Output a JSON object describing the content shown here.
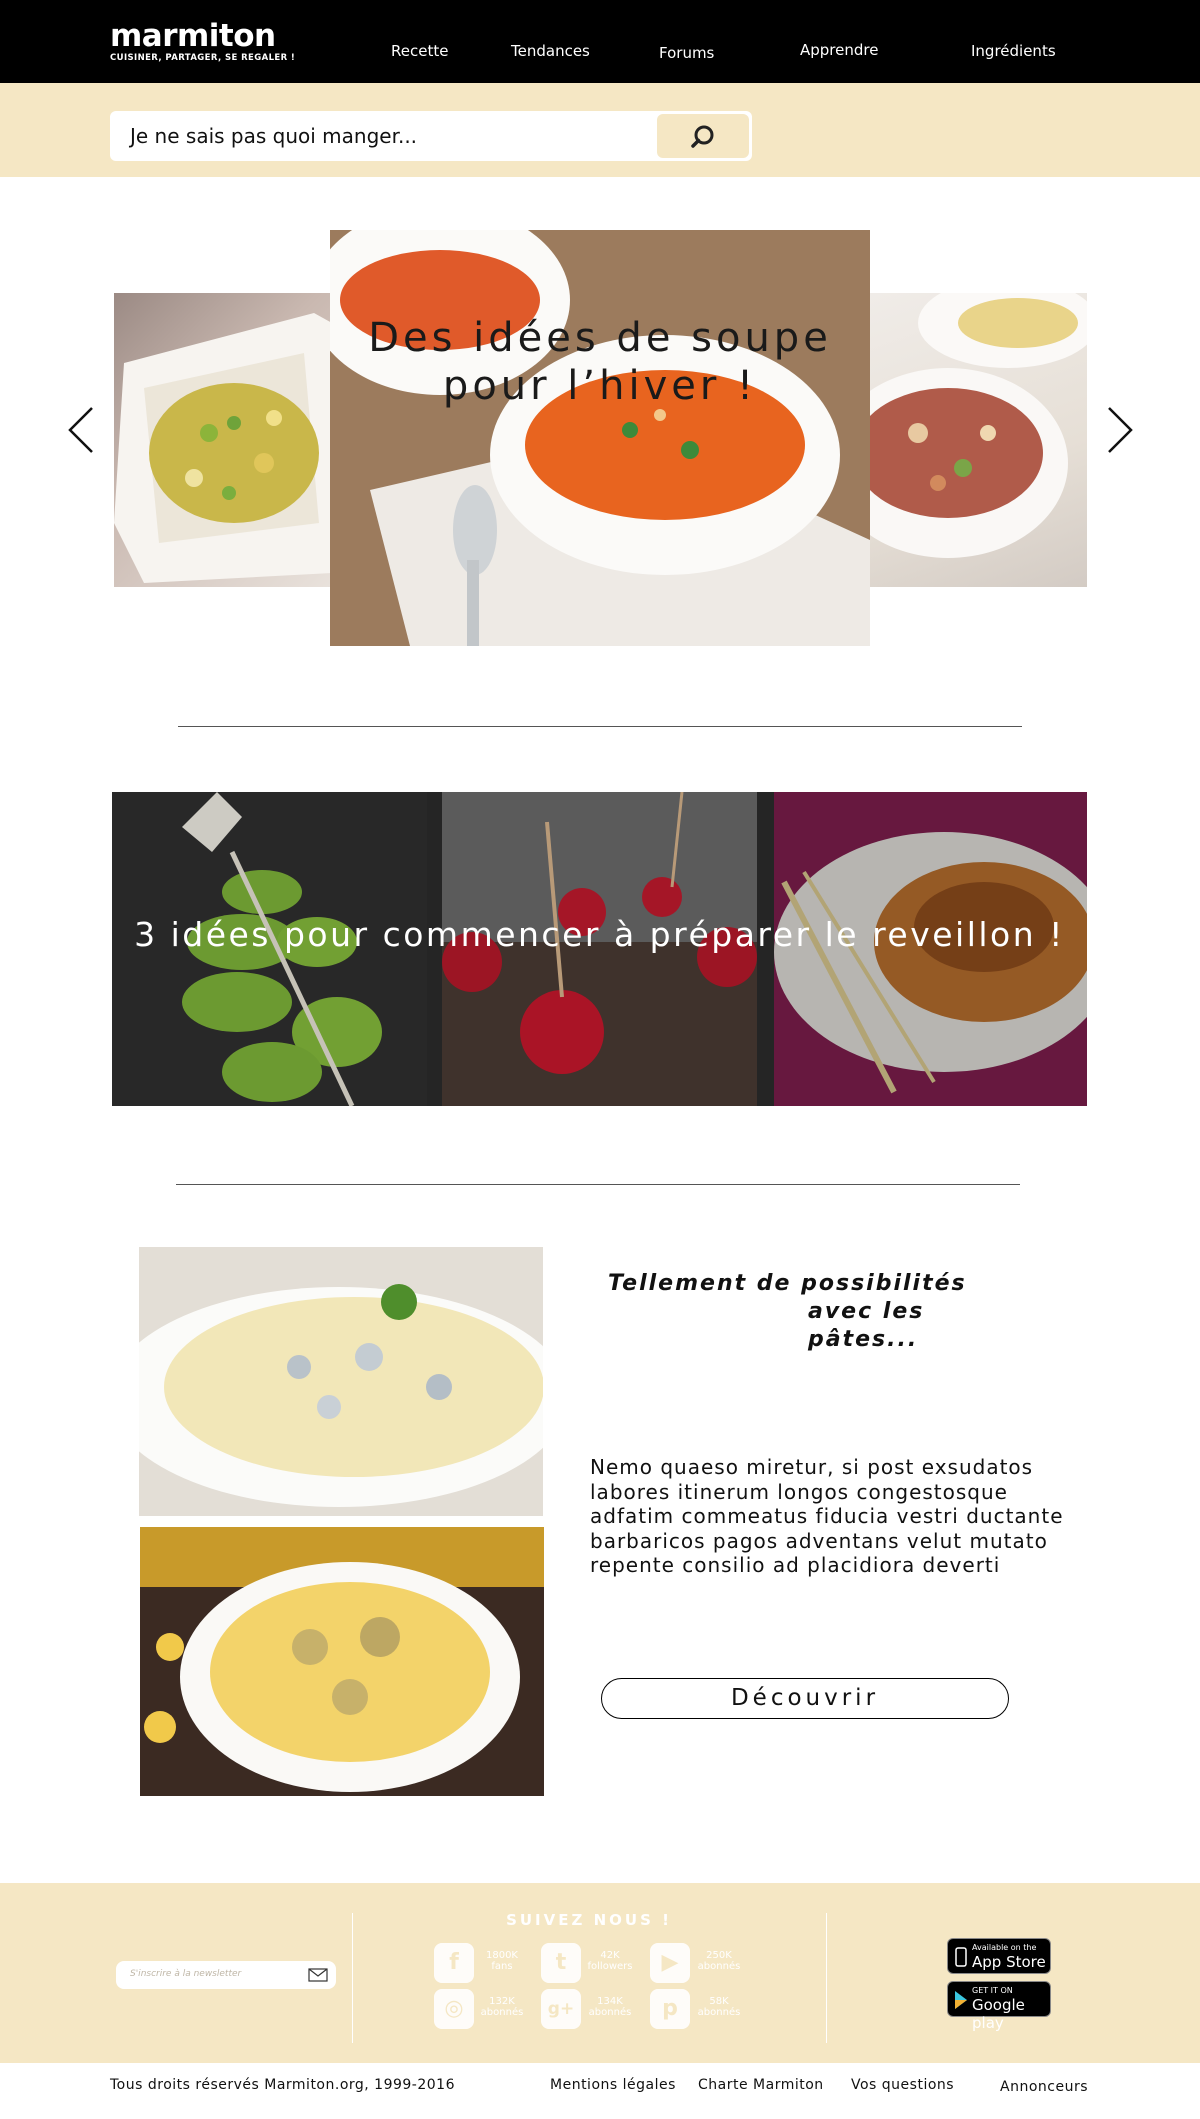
{
  "header": {
    "logo_word": "marmiton",
    "logo_tagline": "CUISINER, PARTAGER, SE REGALER !",
    "nav": [
      "Recette",
      "Tendances",
      "Forums",
      "Apprendre",
      "Ingrédients"
    ]
  },
  "search": {
    "placeholder": "Je ne sais pas quoi manger...",
    "button_icon": "search-icon"
  },
  "carousel": {
    "caption_line1": "Des idées de soupe",
    "caption_line2": "pour l’hiver !",
    "prev_icon": "chevron-left-icon",
    "next_icon": "chevron-right-icon"
  },
  "reveillon": {
    "caption": "3 idées pour commencer à préparer le reveillon !"
  },
  "pasta": {
    "title_line1": "Tellement de possibilités",
    "title_line2": "avec les pâtes...",
    "body": "Nemo quaeso miretur, si post exsudatos\n labores itinerum longos congestosque\nadfatim commeatus fiducia vestri ductante\nbarbaricos pagos adventans velut mutato\n repente consilio ad placidiora deverti",
    "button_label": "Découvrir"
  },
  "footer": {
    "newsletter_placeholder": "S'inscrire à la newsletter",
    "follow_title": "SUIVEZ NOUS !",
    "social": [
      {
        "icon": "facebook-icon",
        "glyph": "f",
        "count": "1800K",
        "unit": "fans"
      },
      {
        "icon": "twitter-icon",
        "glyph": "t",
        "count": "42K",
        "unit": "followers"
      },
      {
        "icon": "youtube-icon",
        "glyph": "▶",
        "count": "250K",
        "unit": "abonnés"
      },
      {
        "icon": "instagram-icon",
        "glyph": "◎",
        "count": "132K",
        "unit": "abonnés"
      },
      {
        "icon": "google-plus-icon",
        "glyph": "g+",
        "count": "134K",
        "unit": "abonnés"
      },
      {
        "icon": "pinterest-icon",
        "glyph": "p",
        "count": "58K",
        "unit": "abonnés"
      }
    ],
    "appstore_small": "Available on the",
    "appstore_big": "App Store",
    "googleplay_small": "GET IT ON",
    "googleplay_big": "Google play"
  },
  "bottom": {
    "copyright": "Tous droits réservés Marmiton.org, 1999-2016",
    "links": [
      "Mentions légales",
      "Charte Marmiton",
      "Vos questions",
      "Annonceurs"
    ]
  }
}
